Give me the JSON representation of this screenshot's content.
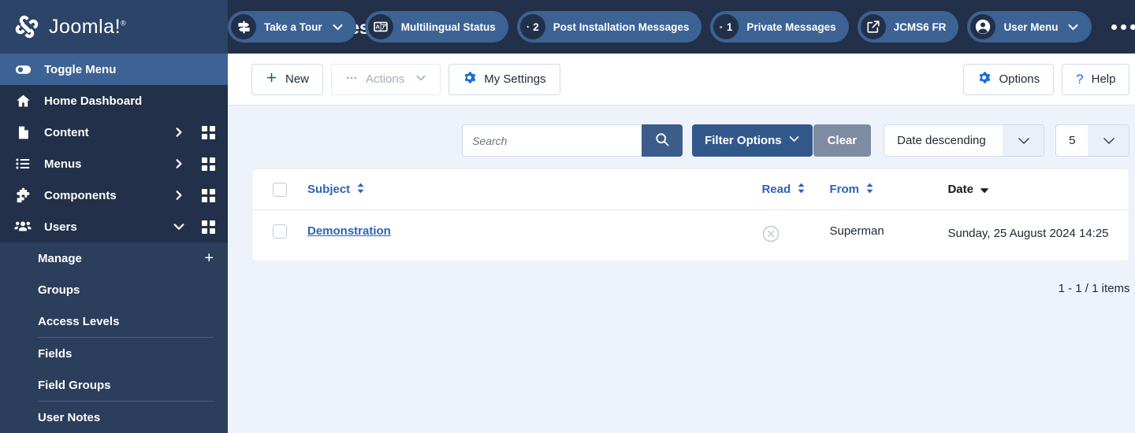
{
  "brand": {
    "name": "Joomla!",
    "trademark": "®",
    "logo_icon": "joomla-logo-icon"
  },
  "sidebar": {
    "toggle": {
      "label": "Toggle Menu",
      "icon": "toggle-switch-icon"
    },
    "items": [
      {
        "label": "Home Dashboard",
        "icon": "home-icon",
        "has_chevron": false,
        "has_grid": false,
        "expanded": false
      },
      {
        "label": "Content",
        "icon": "document-icon",
        "has_chevron": true,
        "has_grid": true,
        "expanded": false
      },
      {
        "label": "Menus",
        "icon": "list-icon",
        "has_chevron": true,
        "has_grid": true,
        "expanded": false
      },
      {
        "label": "Components",
        "icon": "puzzle-icon",
        "has_chevron": true,
        "has_grid": true,
        "expanded": false
      },
      {
        "label": "Users",
        "icon": "users-icon",
        "has_chevron": true,
        "has_grid": true,
        "expanded": true
      }
    ],
    "submenu": [
      {
        "label": "Manage",
        "plus": "+",
        "divider_after": false
      },
      {
        "label": "Groups",
        "plus": "",
        "divider_after": false
      },
      {
        "label": "Access Levels",
        "plus": "",
        "divider_after": true
      },
      {
        "label": "Fields",
        "plus": "",
        "divider_after": false
      },
      {
        "label": "Field Groups",
        "plus": "",
        "divider_after": true
      },
      {
        "label": "User Notes",
        "plus": "",
        "divider_after": false
      }
    ]
  },
  "header": {
    "title": "Private Mes",
    "title_icon": "envelope-icon",
    "pills": [
      {
        "label": "Take a Tour",
        "icon": "signpost-icon",
        "count": "",
        "has_chevron": true
      },
      {
        "label": "Multilingual Status",
        "icon": "language-card-icon",
        "count": "",
        "has_chevron": false
      },
      {
        "label": "Post Installation Messages",
        "icon": "bell-icon",
        "count": "2",
        "has_chevron": false
      },
      {
        "label": "Private Messages",
        "icon": "envelope-icon",
        "count": "1",
        "has_chevron": false
      },
      {
        "label": "JCMS6 FR",
        "icon": "external-link-icon",
        "count": "",
        "has_chevron": false
      },
      {
        "label": "User Menu",
        "icon": "user-circle-icon",
        "count": "",
        "has_chevron": true
      }
    ],
    "overflow_icon": "ellipsis-icon"
  },
  "toolbar": {
    "new_label": "New",
    "new_icon": "plus-icon",
    "actions_label": "Actions",
    "actions_icon": "ellipsis-icon",
    "actions_disabled": true,
    "my_settings_label": "My Settings",
    "my_settings_icon": "gear-icon",
    "options_label": "Options",
    "options_icon": "gear-icon",
    "help_label": "Help",
    "help_icon": "question-mark-icon"
  },
  "filters": {
    "search_value": "",
    "search_placeholder": "Search",
    "search_icon": "magnifier-icon",
    "filter_options_label": "Filter Options",
    "filter_options_icon": "chevron-down-icon",
    "clear_label": "Clear",
    "ordering_value": "Date descending",
    "limit_value": "5"
  },
  "table": {
    "columns": [
      {
        "key": "check",
        "label": "",
        "sortable": false,
        "active": false
      },
      {
        "key": "subject",
        "label": "Subject",
        "sortable": true,
        "active": false
      },
      {
        "key": "read",
        "label": "Read",
        "sortable": true,
        "active": false
      },
      {
        "key": "from",
        "label": "From",
        "sortable": true,
        "active": false
      },
      {
        "key": "date",
        "label": "Date",
        "sortable": true,
        "active": true
      }
    ],
    "rows": [
      {
        "subject": "Demonstration",
        "read_icon": "circle-x-icon",
        "read_state": "unread",
        "from": "Superman",
        "date": "Sunday, 25 August 2024 14:25"
      }
    ]
  },
  "pagination": {
    "counter": "1 - 1 / 1 items"
  },
  "colors": {
    "sidebar_bg": "#22304a",
    "sidebar_sub_bg": "#2b3e5c",
    "brand_bg": "#2c4468",
    "toggle_bg": "#3d6294",
    "pill_bg": "#3d6294",
    "content_bg": "#eef3fb",
    "link_blue": "#2b62b8",
    "filter_blue": "#33598c",
    "clear_grey": "#7e8ca3",
    "accent_green": "#157347",
    "accent_blue": "#1a6ed8"
  }
}
